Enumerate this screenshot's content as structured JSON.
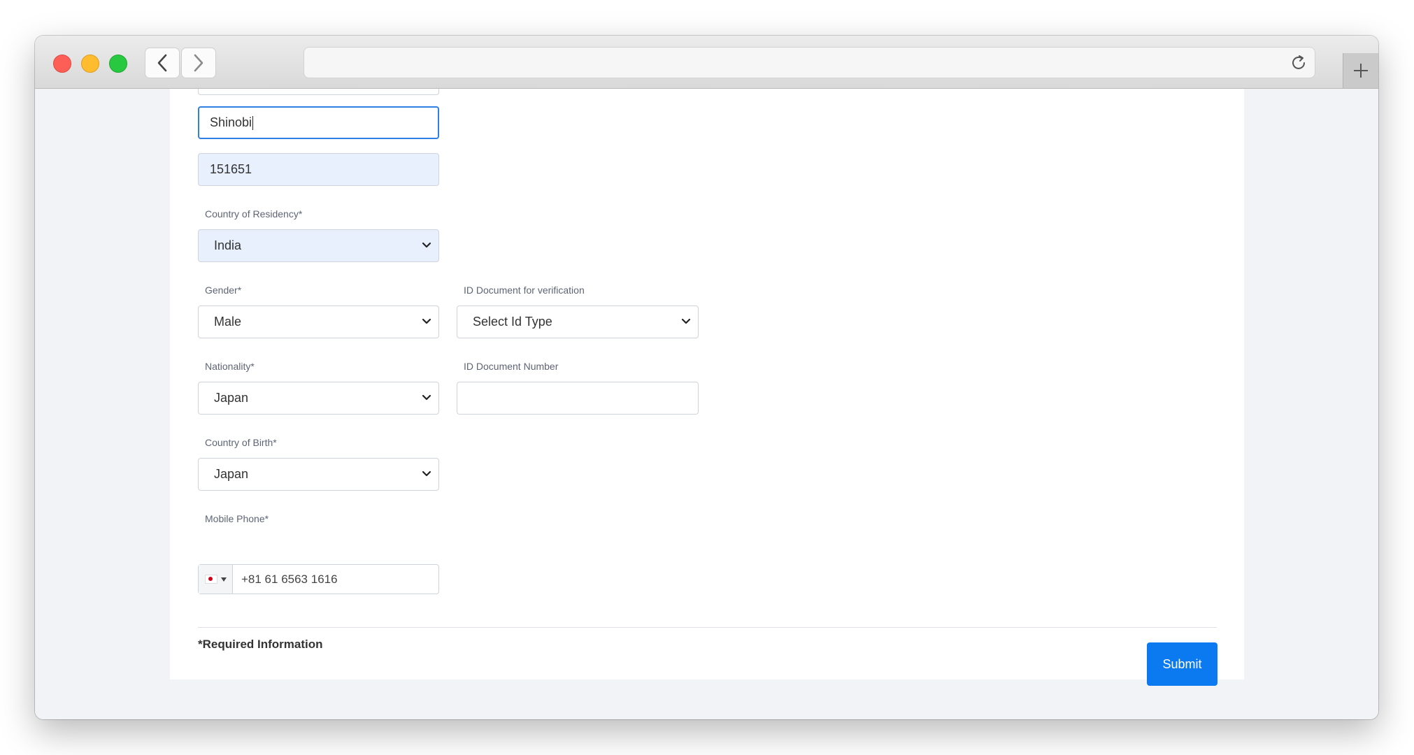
{
  "browser": {
    "url": ""
  },
  "form": {
    "partial_field_value": "",
    "last_name_value": "Shinobi",
    "zip_value": "151651",
    "residency": {
      "label": "Country of Residency*",
      "value": "India"
    },
    "gender": {
      "label": "Gender*",
      "value": "Male"
    },
    "id_doc_type": {
      "label": "ID Document for verification",
      "value": "Select Id Type"
    },
    "nationality": {
      "label": "Nationality*",
      "value": "Japan"
    },
    "id_doc_number": {
      "label": "ID Document Number",
      "value": ""
    },
    "birth_country": {
      "label": "Country of Birth*",
      "value": "Japan"
    },
    "mobile": {
      "label": "Mobile Phone*",
      "flag": "japan-flag-icon",
      "number": "+81 61 6563 1616"
    },
    "required_note": "*Required Information",
    "submit_label": "Submit"
  },
  "colors": {
    "accent": "#0b79f0",
    "focus_border": "#2f7fe4",
    "autofill_bg": "#e8f0fe"
  }
}
